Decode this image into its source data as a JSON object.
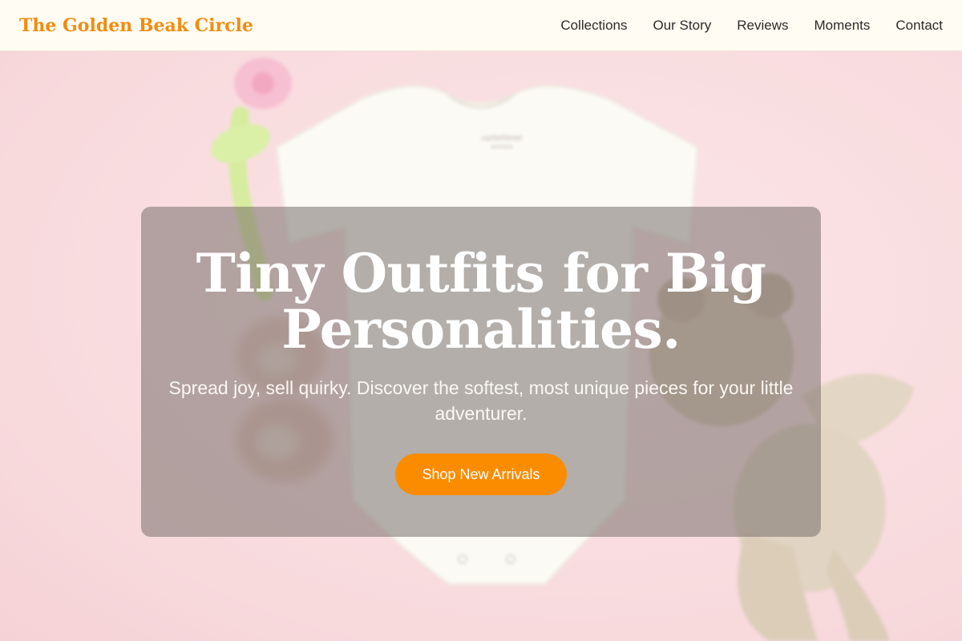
{
  "brand": {
    "name": "The Golden Beak Circle"
  },
  "nav": {
    "items": [
      {
        "label": "Collections"
      },
      {
        "label": "Our Story"
      },
      {
        "label": "Reviews"
      },
      {
        "label": "Moments"
      },
      {
        "label": "Contact"
      }
    ]
  },
  "hero": {
    "headline": "Tiny Outfits for Big Personalities.",
    "subtitle": "Spread joy, sell quirky. Discover the softest, most unique pieces for your little adventurer.",
    "cta_label": "Shop New Arrivals",
    "onesie_tag": "carterlover"
  },
  "colors": {
    "accent": "#fb8c00",
    "brand_text": "#f28c0f",
    "header_bg": "#fffcf3",
    "hero_bg": "#f8dadd"
  }
}
